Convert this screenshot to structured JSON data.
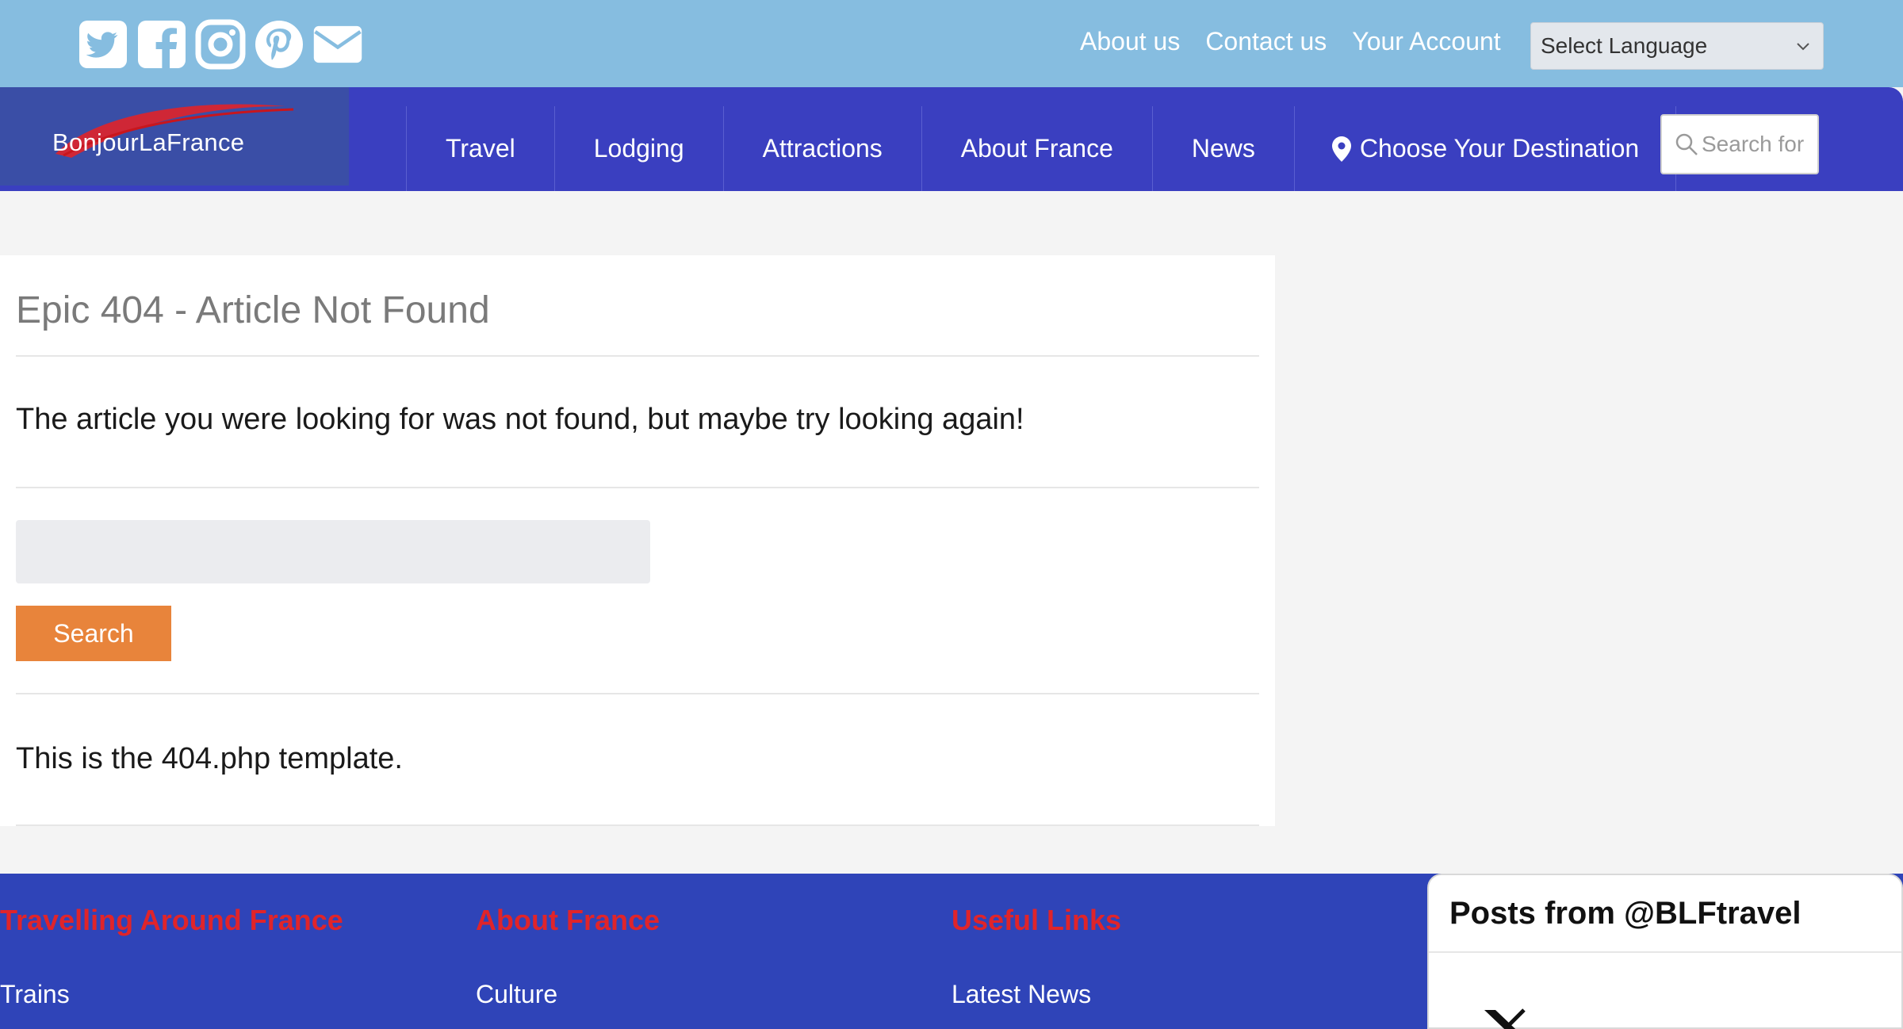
{
  "topbar": {
    "social_icons": [
      "twitter-icon",
      "facebook-icon",
      "instagram-icon",
      "pinterest-icon",
      "mail-icon"
    ],
    "links": [
      "About us",
      "Contact us",
      "Your Account"
    ],
    "language_select": "Select Language"
  },
  "nav": {
    "logo_text": "BonjourLaFrance",
    "items": [
      "Travel",
      "Lodging",
      "Attractions",
      "About France",
      "News",
      "Choose Your Destination"
    ],
    "search_placeholder": "Search for"
  },
  "main": {
    "title": "Epic 404 - Article Not Found",
    "message": "The article you were looking for was not found, but maybe try looking again!",
    "search_button": "Search",
    "template_note": "This is the 404.php template."
  },
  "footer": {
    "columns": [
      {
        "heading": "Travelling Around France",
        "link": "Trains"
      },
      {
        "heading": "About France",
        "link": "Culture"
      },
      {
        "heading": "Useful Links",
        "link": "Latest News"
      }
    ],
    "twitter_widget_title": "Posts from @BLFtravel"
  },
  "colors": {
    "topbar": "#86bde0",
    "nav": "#3a3fc0",
    "search_button": "#e8843b",
    "footer": "#2f44b8",
    "footer_heading": "#e0242a"
  }
}
